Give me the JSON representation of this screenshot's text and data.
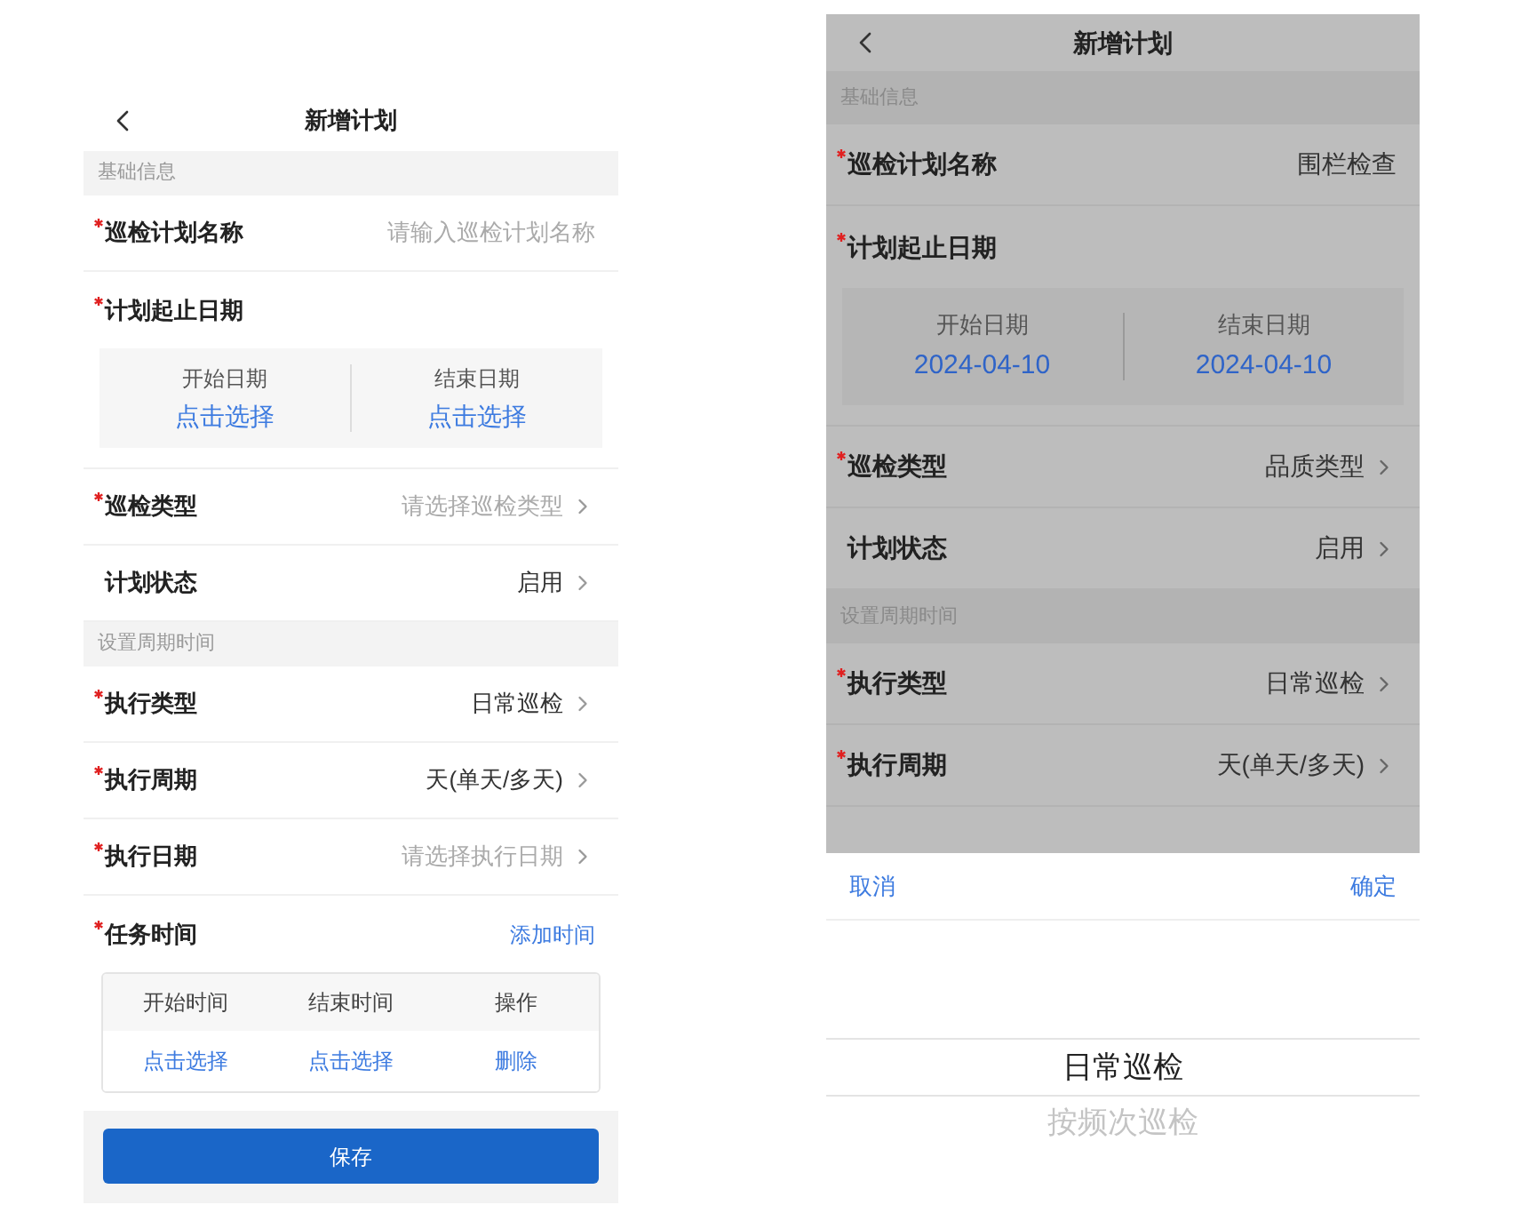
{
  "screens": [
    {
      "title": "新增计划",
      "dimmed": false,
      "sections": [
        {
          "header": "基础信息",
          "rows": [
            {
              "kind": "input",
              "label": "巡检计划名称",
              "required": true,
              "placeholder": "请输入巡检计划名称"
            },
            {
              "kind": "date_range",
              "label": "计划起止日期",
              "required": true,
              "start_label": "开始日期",
              "start_value": "点击选择",
              "end_label": "结束日期",
              "end_value": "点击选择"
            },
            {
              "kind": "select",
              "label": "巡检类型",
              "required": true,
              "placeholder": "请选择巡检类型"
            },
            {
              "kind": "select",
              "label": "计划状态",
              "required": false,
              "value": "启用"
            }
          ]
        },
        {
          "header": "设置周期时间",
          "rows": [
            {
              "kind": "select",
              "label": "执行类型",
              "required": true,
              "value": "日常巡检"
            },
            {
              "kind": "select",
              "label": "执行周期",
              "required": true,
              "value": "天(单天/多天)"
            },
            {
              "kind": "select",
              "label": "执行日期",
              "required": true,
              "placeholder": "请选择执行日期"
            },
            {
              "kind": "task_time",
              "label": "任务时间",
              "required": true,
              "action": "添加时间",
              "columns": [
                "开始时间",
                "结束时间",
                "操作"
              ],
              "cells": [
                "点击选择",
                "点击选择",
                "删除"
              ]
            }
          ]
        }
      ],
      "save_button": "保存"
    },
    {
      "title": "新增计划",
      "dimmed": true,
      "sections": [
        {
          "header": "基础信息",
          "rows": [
            {
              "kind": "input",
              "label": "巡检计划名称",
              "required": true,
              "value": "围栏检查"
            },
            {
              "kind": "date_range",
              "label": "计划起止日期",
              "required": true,
              "start_label": "开始日期",
              "start_value": "2024-04-10",
              "end_label": "结束日期",
              "end_value": "2024-04-10"
            },
            {
              "kind": "select",
              "label": "巡检类型",
              "required": true,
              "value": "品质类型"
            },
            {
              "kind": "select",
              "label": "计划状态",
              "required": false,
              "value": "启用"
            }
          ]
        },
        {
          "header": "设置周期时间",
          "rows": [
            {
              "kind": "select",
              "label": "执行类型",
              "required": true,
              "value": "日常巡检"
            },
            {
              "kind": "select",
              "label": "执行周期",
              "required": true,
              "value": "天(单天/多天)"
            }
          ]
        }
      ],
      "picker": {
        "cancel": "取消",
        "confirm": "确定",
        "options": [
          {
            "label": "日常巡检",
            "selected": true
          },
          {
            "label": "按频次巡检",
            "selected": false
          }
        ]
      }
    }
  ]
}
